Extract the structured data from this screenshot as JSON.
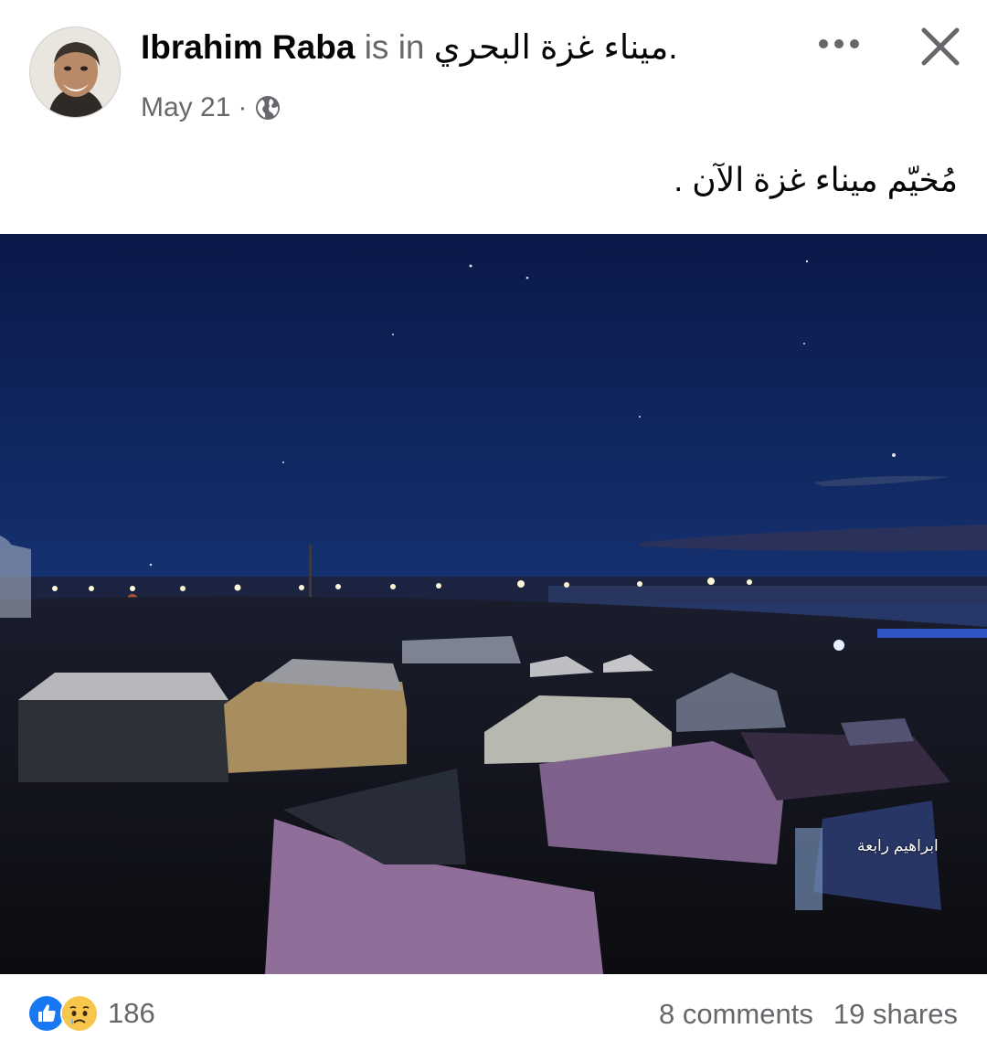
{
  "post": {
    "author": "Ibrahim Raba",
    "checkin_connector": "is in",
    "place": "ميناء غزة البحري",
    "place_suffix": ".",
    "date": "May 21",
    "meta_separator": "·",
    "privacy_icon": "globe-icon",
    "text": "مُخيّم ميناء غزة الآن .",
    "photo_watermark": "ابراهيم رابعة"
  },
  "header_actions": {
    "more_icon": "more-horizontal-icon",
    "close_icon": "close-icon"
  },
  "footer": {
    "reaction_icons": [
      "like-icon",
      "sad-icon"
    ],
    "reaction_count": "186",
    "comments": "8 comments",
    "shares": "19 shares"
  },
  "colors": {
    "text_primary": "#050505",
    "text_secondary": "#65676b",
    "like_blue": "#1877f2",
    "sad_yellow": "#f7c64c"
  }
}
